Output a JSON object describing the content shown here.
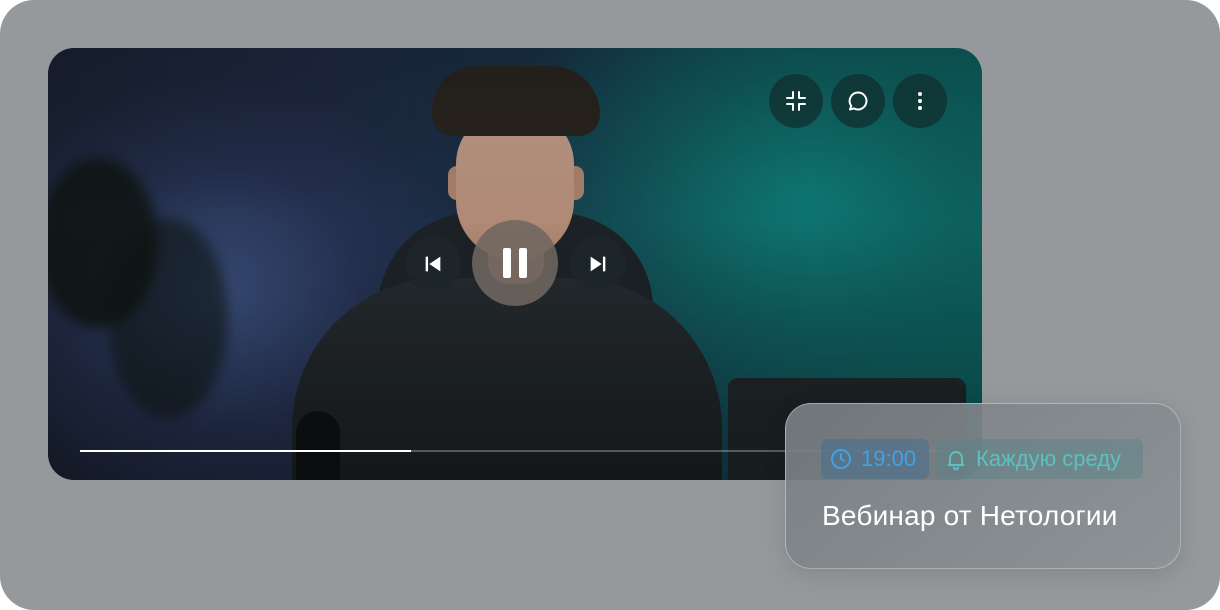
{
  "player": {
    "progress_fraction": 0.38,
    "icons": {
      "exit_fullscreen": "exit-fullscreen-icon",
      "chat": "chat-icon",
      "more": "more-vertical-icon",
      "previous": "skip-previous-icon",
      "pause": "pause-icon",
      "next": "skip-next-icon"
    }
  },
  "event_card": {
    "time": "19:00",
    "repeat": "Каждую среду",
    "title": "Вебинар от Нетологии",
    "time_color": "#3fa2e6",
    "repeat_color": "#58c2c2"
  }
}
